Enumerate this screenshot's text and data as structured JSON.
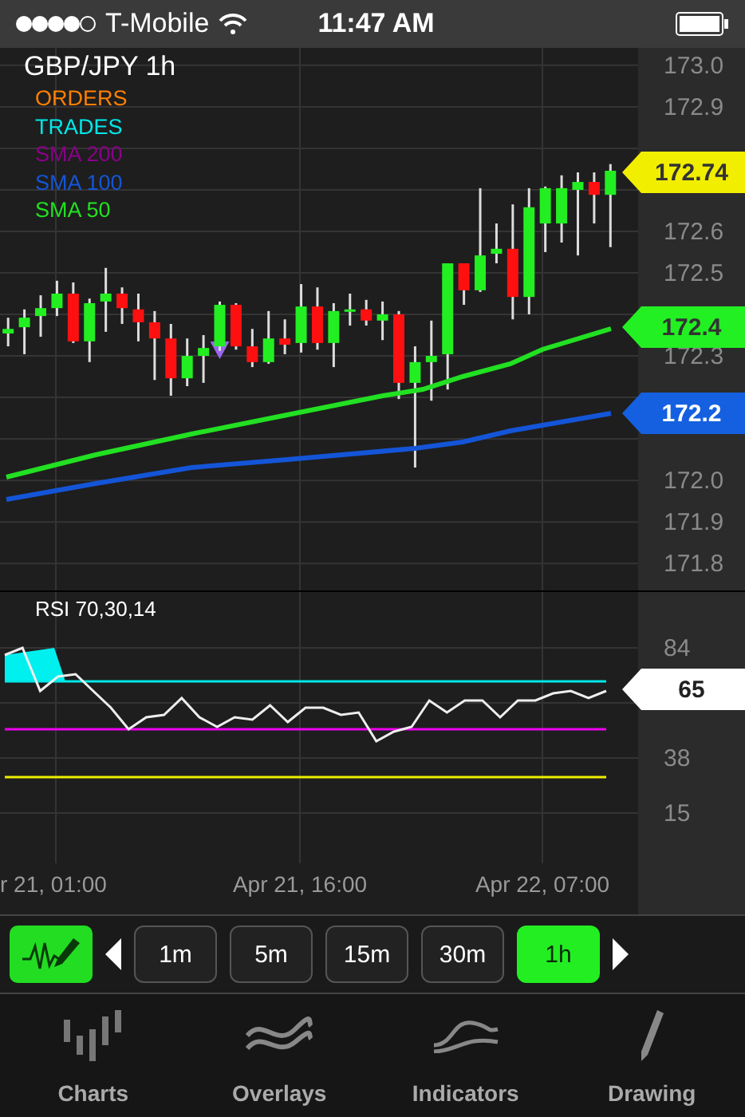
{
  "status_bar": {
    "carrier": "T-Mobile",
    "time": "11:47 AM"
  },
  "chart": {
    "title": "GBP/JPY 1h",
    "legend": [
      {
        "label": "ORDERS",
        "color": "#ff8000"
      },
      {
        "label": "TRADES",
        "color": "#00e8e8"
      },
      {
        "label": "SMA 200",
        "color": "#8a008a"
      },
      {
        "label": "SMA 100",
        "color": "#1455d8"
      },
      {
        "label": "SMA 50",
        "color": "#22e022"
      }
    ],
    "price_tags": [
      {
        "label": "172.74",
        "color": "#f2ee00"
      },
      {
        "label": "172.4",
        "color": "#22f022"
      },
      {
        "label": "172.2",
        "color": "#1560e0"
      }
    ],
    "chart_data": {
      "type": "candlestick",
      "grid": true,
      "ylim": [
        171.735,
        173.042
      ],
      "yticks": [
        {
          "value": 173.0,
          "label": "173.0"
        },
        {
          "value": 172.9,
          "label": "172.9"
        },
        {
          "value": 172.6,
          "label": "172.6"
        },
        {
          "value": 172.5,
          "label": "172.5"
        },
        {
          "value": 172.3,
          "label": "172.3"
        },
        {
          "value": 172.0,
          "label": "172.0"
        },
        {
          "value": 171.9,
          "label": "171.9"
        },
        {
          "value": 171.8,
          "label": "171.8"
        }
      ],
      "categories": [
        null,
        null,
        null,
        null,
        null,
        null,
        null,
        null,
        null,
        null,
        null,
        null,
        null,
        null,
        null,
        null,
        null,
        null,
        null,
        null,
        null,
        null,
        null,
        null,
        null,
        null,
        null,
        null,
        null,
        null,
        null,
        null,
        null,
        null,
        null,
        null,
        null,
        null
      ],
      "ohlc": [
        [
          172.354,
          172.392,
          172.323,
          172.365
        ],
        [
          172.369,
          172.412,
          172.304,
          172.392
        ],
        [
          172.396,
          172.446,
          172.346,
          172.415
        ],
        [
          172.415,
          172.481,
          172.396,
          172.45
        ],
        [
          172.45,
          172.477,
          172.331,
          172.335
        ],
        [
          172.335,
          172.438,
          172.285,
          172.427
        ],
        [
          172.431,
          172.512,
          172.358,
          172.45
        ],
        [
          172.45,
          172.465,
          172.377,
          172.415
        ],
        [
          172.412,
          172.45,
          172.335,
          172.381
        ],
        [
          172.381,
          172.408,
          172.242,
          172.342
        ],
        [
          172.342,
          172.377,
          172.204,
          172.246
        ],
        [
          172.246,
          172.342,
          172.227,
          172.3
        ],
        [
          172.3,
          172.35,
          172.235,
          172.319
        ],
        [
          172.323,
          172.431,
          172.312,
          172.423
        ],
        [
          172.423,
          172.427,
          172.315,
          172.323
        ],
        [
          172.323,
          172.365,
          172.273,
          172.285
        ],
        [
          172.285,
          172.408,
          172.281,
          172.342
        ],
        [
          172.342,
          172.388,
          172.304,
          172.327
        ],
        [
          172.331,
          172.473,
          172.308,
          172.419
        ],
        [
          172.419,
          172.465,
          172.315,
          172.331
        ],
        [
          172.331,
          172.427,
          172.273,
          172.408
        ],
        [
          172.408,
          172.45,
          172.373,
          172.412
        ],
        [
          172.412,
          172.435,
          172.373,
          172.385
        ],
        [
          172.385,
          172.431,
          172.338,
          172.4
        ],
        [
          172.4,
          172.408,
          172.196,
          172.235
        ],
        [
          172.235,
          172.323,
          172.031,
          172.285
        ],
        [
          172.285,
          172.385,
          172.192,
          172.3
        ],
        [
          172.304,
          172.523,
          172.219,
          172.523
        ],
        [
          172.523,
          172.523,
          172.423,
          172.458
        ],
        [
          172.458,
          172.704,
          172.454,
          172.542
        ],
        [
          172.546,
          172.619,
          172.523,
          172.558
        ],
        [
          172.558,
          172.665,
          172.388,
          172.442
        ],
        [
          172.442,
          172.704,
          172.4,
          172.658
        ],
        [
          172.619,
          172.708,
          172.55,
          172.704
        ],
        [
          172.619,
          172.735,
          172.573,
          172.704
        ],
        [
          172.7,
          172.742,
          172.542,
          172.719
        ],
        [
          172.719,
          172.742,
          172.619,
          172.688
        ],
        [
          172.688,
          172.762,
          172.562,
          172.746
        ]
      ]
    }
  },
  "rsi": {
    "title": "RSI 70,30,14",
    "tag": "65",
    "chart_data": {
      "type": "line",
      "grid": true,
      "ylim": [
        -6,
        107.3
      ],
      "yticks": [
        84,
        38,
        15
      ],
      "series": [
        {
          "color": "#eeeeee",
          "values": [
            81,
            84,
            66,
            72,
            73,
            66,
            59,
            50,
            55,
            56,
            63,
            55,
            51,
            55,
            54,
            60,
            53,
            59,
            59,
            56,
            57,
            45,
            49,
            51,
            62,
            57,
            62,
            62,
            55,
            62,
            62,
            65,
            66,
            63,
            66
          ]
        },
        {
          "color": "#00e8e8",
          "values": [
            70,
            70,
            70,
            70,
            70,
            70,
            70,
            70,
            70,
            70,
            70,
            70,
            70,
            70,
            70,
            70,
            70,
            70,
            70,
            70,
            70,
            70,
            70,
            70,
            70,
            70,
            70,
            70,
            70,
            70,
            70,
            70,
            70,
            70,
            70
          ]
        },
        {
          "color": "#ee00ee",
          "values": [
            50,
            50,
            50,
            50,
            50,
            50,
            50,
            50,
            50,
            50,
            50,
            50,
            50,
            50,
            50,
            50,
            50,
            50,
            50,
            50,
            50,
            50,
            50,
            50,
            50,
            50,
            50,
            50,
            50,
            50,
            50,
            50,
            50,
            50,
            50
          ]
        },
        {
          "color": "#eeee00",
          "values": [
            30,
            30,
            30,
            30,
            30,
            30,
            30,
            30,
            30,
            30,
            30,
            30,
            30,
            30,
            30,
            30,
            30,
            30,
            30,
            30,
            30,
            30,
            30,
            30,
            30,
            30,
            30,
            30,
            30,
            30,
            30,
            30,
            30,
            30,
            30
          ]
        }
      ]
    }
  },
  "time_axis": [
    "r 21, 01:00",
    "Apr 21, 16:00",
    "Apr 22, 07:00"
  ],
  "timeframes": [
    {
      "label": "1m",
      "selected": false
    },
    {
      "label": "5m",
      "selected": false
    },
    {
      "label": "15m",
      "selected": false
    },
    {
      "label": "30m",
      "selected": false
    },
    {
      "label": "1h",
      "selected": true
    }
  ],
  "tabs": [
    {
      "label": "Charts",
      "kind": "bars"
    },
    {
      "label": "Overlays",
      "kind": "waves"
    },
    {
      "label": "Indicators",
      "kind": "curve"
    },
    {
      "label": "Drawing",
      "kind": "pencil"
    }
  ]
}
